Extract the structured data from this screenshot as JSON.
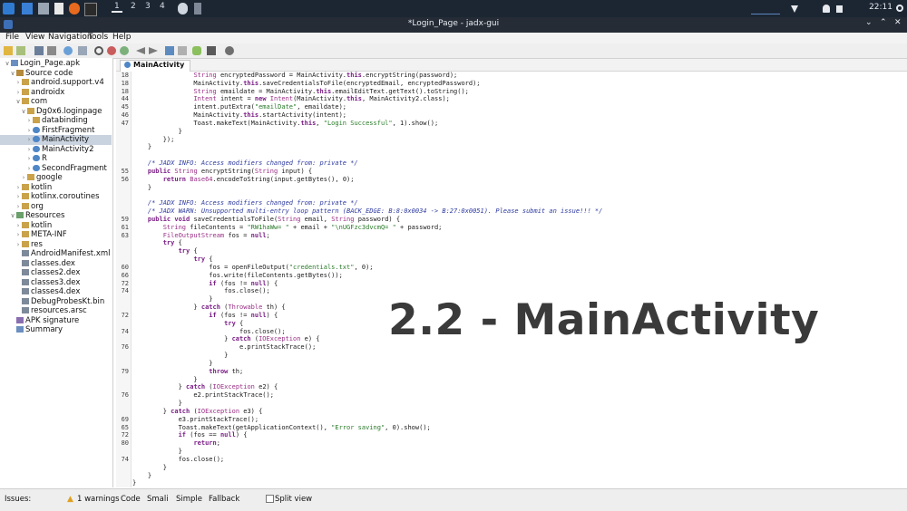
{
  "panel": {
    "workspaces": [
      "1",
      "2",
      "3",
      "4"
    ],
    "clock": "22:11",
    "icons": [
      "app-menu-icon",
      "desktop-icon",
      "files-icon",
      "text-editor-icon",
      "firefox-icon",
      "terminal-icon",
      "workspace-separator",
      "jadx-icon",
      "window-list-icon",
      "network-graph-icon",
      "download-icon",
      "bell-icon",
      "lock-icon",
      "power-icon"
    ]
  },
  "window": {
    "title": "*Login_Page - jadx-gui"
  },
  "menu": [
    "File",
    "View",
    "Navigation",
    "Tools",
    "Help"
  ],
  "toolbar_icons": [
    "open-file-icon",
    "add-files-icon",
    "save-icon",
    "export-icon",
    "sync-icon",
    "expand-all-icon",
    "search-icon",
    "find-class-icon",
    "find-usage-icon",
    "back-icon",
    "forward-icon",
    "decompile-icon",
    "log-icon",
    "android-icon",
    "debug-icon",
    "settings-icon"
  ],
  "tree": [
    {
      "label": "Login_Page.apk",
      "icon": "apk-icon"
    },
    {
      "label": "Source code",
      "icon": "source-icon"
    },
    {
      "label": "android.support.v4",
      "icon": "package-icon"
    },
    {
      "label": "androidx",
      "icon": "package-icon"
    },
    {
      "label": "com",
      "icon": "package-icon"
    },
    {
      "label": "Dg0x6.loginpage",
      "icon": "package-icon"
    },
    {
      "label": "databinding",
      "icon": "package-icon"
    },
    {
      "label": "FirstFragment",
      "icon": "class-icon"
    },
    {
      "label": "MainActivity",
      "icon": "class-icon",
      "selected": true
    },
    {
      "label": "MainActivity2",
      "icon": "class-icon"
    },
    {
      "label": "R",
      "icon": "class-icon"
    },
    {
      "label": "SecondFragment",
      "icon": "class-icon"
    },
    {
      "label": "google",
      "icon": "package-icon"
    },
    {
      "label": "kotlin",
      "icon": "package-icon"
    },
    {
      "label": "kotlinx.coroutines",
      "icon": "package-icon"
    },
    {
      "label": "org",
      "icon": "package-icon"
    },
    {
      "label": "Resources",
      "icon": "resources-icon"
    },
    {
      "label": "kotlin",
      "icon": "folder-icon"
    },
    {
      "label": "META-INF",
      "icon": "folder-icon"
    },
    {
      "label": "res",
      "icon": "folder-icon"
    },
    {
      "label": "AndroidManifest.xml",
      "icon": "file-icon"
    },
    {
      "label": "classes.dex",
      "icon": "file-icon"
    },
    {
      "label": "classes2.dex",
      "icon": "file-icon"
    },
    {
      "label": "classes3.dex",
      "icon": "file-icon"
    },
    {
      "label": "classes4.dex",
      "icon": "file-icon"
    },
    {
      "label": "DebugProbesKt.bin",
      "icon": "file-icon"
    },
    {
      "label": "resources.arsc",
      "icon": "file-icon"
    },
    {
      "label": "APK signature",
      "icon": "signature-icon"
    },
    {
      "label": "Summary",
      "icon": "summary-icon"
    }
  ],
  "tab": {
    "label": "MainActivity"
  },
  "code": [
    {
      "n": "18",
      "t": "                String encryptedPassword = MainActivity.this.encryptString(password);"
    },
    {
      "n": "18",
      "t": "                MainActivity.this.saveCredentialsToFile(encryptedEmail, encryptedPassword);"
    },
    {
      "n": "18",
      "t": "                String emaildate = MainActivity.this.emailEditText.getText().toString();"
    },
    {
      "n": "44",
      "t": "                Intent intent = new Intent(MainActivity.this, MainActivity2.class);"
    },
    {
      "n": "45",
      "t": "                intent.putExtra(\"emailDate\", emaildate);"
    },
    {
      "n": "46",
      "t": "                MainActivity.this.startActivity(intent);"
    },
    {
      "n": "47",
      "t": "                Toast.makeText(MainActivity.this, \"Login Successful\", 1).show();"
    },
    {
      "n": "",
      "t": "            }"
    },
    {
      "n": "",
      "t": "        });"
    },
    {
      "n": "",
      "t": "    }"
    },
    {
      "n": "",
      "t": ""
    },
    {
      "n": "",
      "t": "    /* JADX INFO: Access modifiers changed from: private */"
    },
    {
      "n": "55",
      "t": "    public String encryptString(String input) {"
    },
    {
      "n": "56",
      "t": "        return Base64.encodeToString(input.getBytes(), 0);"
    },
    {
      "n": "",
      "t": "    }"
    },
    {
      "n": "",
      "t": ""
    },
    {
      "n": "",
      "t": "    /* JADX INFO: Access modifiers changed from: private */"
    },
    {
      "n": "",
      "t": "    /* JADX WARN: Unsupported multi-entry loop pattern (BACK_EDGE: B:8:0x0034 -> B:27:0x0051). Please submit an issue!!! */"
    },
    {
      "n": "59",
      "t": "    public void saveCredentialsToFile(String email, String password) {"
    },
    {
      "n": "61",
      "t": "        String fileContents = \"RW1haWw= \" + email + \"\\nUGFzc3dvcmQ= \" + password;"
    },
    {
      "n": "63",
      "t": "        FileOutputStream fos = null;"
    },
    {
      "n": "",
      "t": "        try {"
    },
    {
      "n": "",
      "t": "            try {"
    },
    {
      "n": "",
      "t": "                try {"
    },
    {
      "n": "60",
      "t": "                    fos = openFileOutput(\"credentials.txt\", 0);"
    },
    {
      "n": "66",
      "t": "                    fos.write(fileContents.getBytes());"
    },
    {
      "n": "72",
      "t": "                    if (fos != null) {"
    },
    {
      "n": "74",
      "t": "                        fos.close();"
    },
    {
      "n": "",
      "t": "                    }"
    },
    {
      "n": "",
      "t": "                } catch (Throwable th) {"
    },
    {
      "n": "72",
      "t": "                    if (fos != null) {"
    },
    {
      "n": "",
      "t": "                        try {"
    },
    {
      "n": "74",
      "t": "                            fos.close();"
    },
    {
      "n": "",
      "t": "                        } catch (IOException e) {"
    },
    {
      "n": "76",
      "t": "                            e.printStackTrace();"
    },
    {
      "n": "",
      "t": "                        }"
    },
    {
      "n": "",
      "t": "                    }"
    },
    {
      "n": "79",
      "t": "                    throw th;"
    },
    {
      "n": "",
      "t": "                }"
    },
    {
      "n": "",
      "t": "            } catch (IOException e2) {"
    },
    {
      "n": "76",
      "t": "                e2.printStackTrace();"
    },
    {
      "n": "",
      "t": "            }"
    },
    {
      "n": "",
      "t": "        } catch (IOException e3) {"
    },
    {
      "n": "69",
      "t": "            e3.printStackTrace();"
    },
    {
      "n": "65",
      "t": "            Toast.makeText(getApplicationContext(), \"Error saving\", 0).show();"
    },
    {
      "n": "72",
      "t": "            if (fos == null) {"
    },
    {
      "n": "80",
      "t": "                return;"
    },
    {
      "n": "",
      "t": "            }"
    },
    {
      "n": "74",
      "t": "            fos.close();"
    },
    {
      "n": "",
      "t": "        }"
    },
    {
      "n": "",
      "t": "    }"
    },
    {
      "n": "",
      "t": "}"
    }
  ],
  "overlay_text": "2.2 - MainActivity",
  "status": {
    "issues_label": "Issues:",
    "warnings": "1 warnings",
    "tabs": [
      "Code",
      "Smali",
      "Simple",
      "Fallback"
    ],
    "split_view": "Split view"
  },
  "colors": {
    "panel": "#1c2633",
    "titlebar": "#252c36",
    "selection": "#c9d3df",
    "keyword": "#7a1f85",
    "string": "#2a7b2a",
    "comment": "#2e3ba0"
  }
}
